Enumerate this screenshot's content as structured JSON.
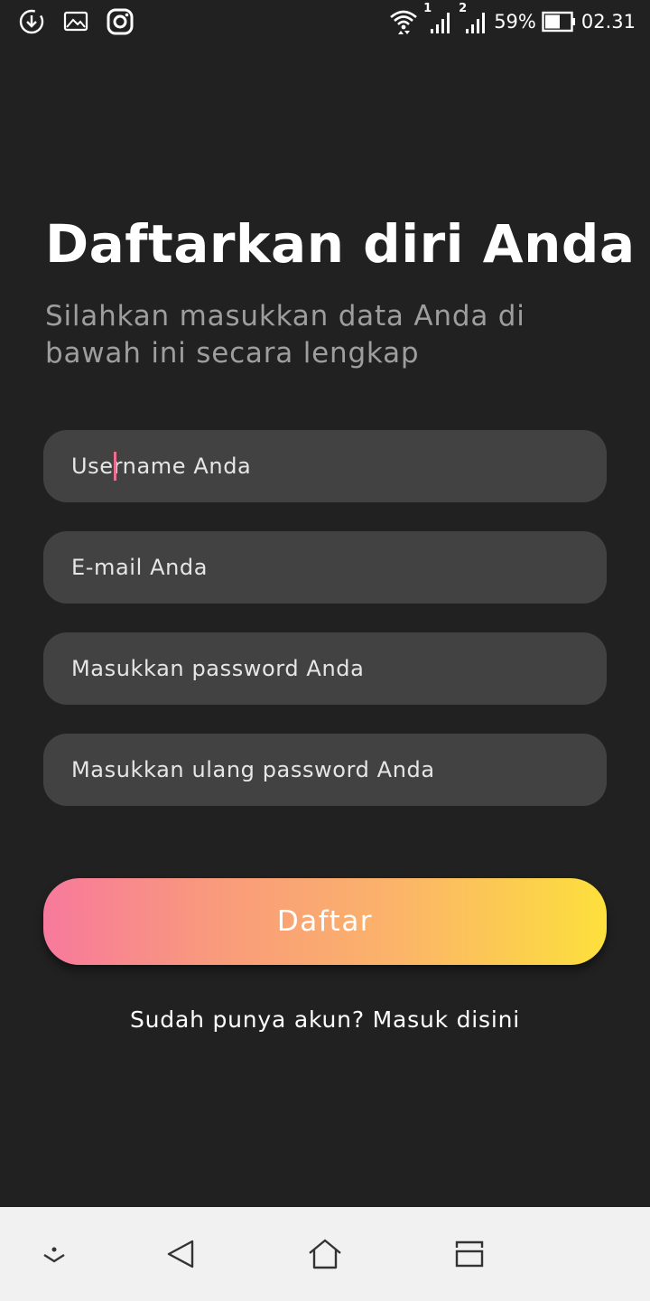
{
  "status_bar": {
    "left_icons": [
      "download-icon",
      "image-icon",
      "instagram-icon"
    ],
    "sim1": "1",
    "sim2": "2",
    "battery": "59%",
    "time": "02.31"
  },
  "heading": {
    "title": "Daftarkan diri Anda",
    "subtitle": "Silahkan masukkan data Anda di bawah ini secara lengkap"
  },
  "form": {
    "username_placeholder": "Username Anda",
    "email_placeholder": "E-mail Anda",
    "password_placeholder": "Masukkan password Anda",
    "confirm_password_placeholder": "Masukkan ulang password Anda",
    "submit_label": "Daftar"
  },
  "login_link": "Sudah punya akun? Masuk disini",
  "colors": {
    "background": "#212121",
    "field": "#424242",
    "gradient_start": "#f7799c",
    "gradient_end": "#fde03c",
    "caret": "#ec6f91"
  },
  "nav_bar": {
    "icons": [
      "notification-shade-icon",
      "back-icon",
      "home-icon",
      "recents-icon"
    ]
  }
}
